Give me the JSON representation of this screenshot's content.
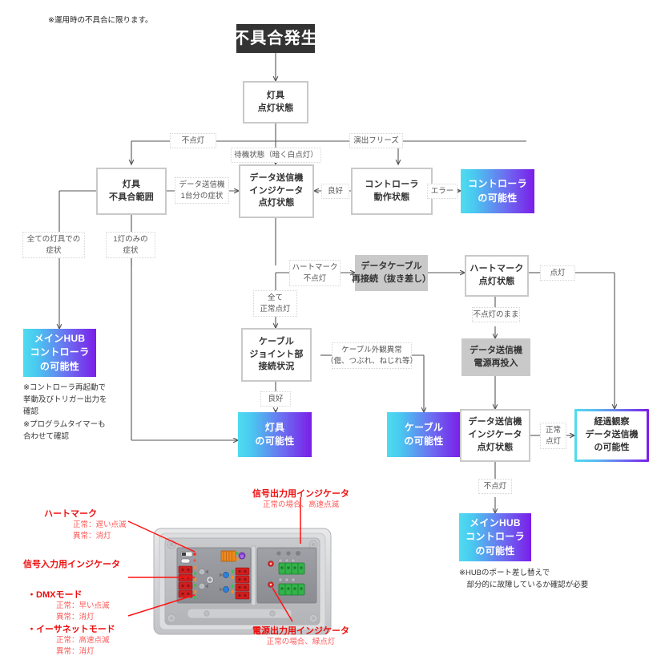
{
  "top_note": "※運用時の不具合に限ります。",
  "nodes": {
    "start": {
      "lines": [
        "不具合発生"
      ]
    },
    "fixture_state": {
      "lines": [
        "灯具",
        "点灯状態"
      ]
    },
    "fixture_range": {
      "lines": [
        "灯具",
        "不具合範囲"
      ]
    },
    "tx_indicator": {
      "lines": [
        "データ送信機",
        "インジケータ",
        "点灯状態"
      ]
    },
    "controller_state": {
      "lines": [
        "コントローラ",
        "動作状態"
      ]
    },
    "controller_maybe": {
      "lines": [
        "コントローラ",
        "の可能性"
      ]
    },
    "mainhub_left": {
      "lines": [
        "メインHUB",
        "コントローラ",
        "の可能性"
      ]
    },
    "datacable_recon": {
      "lines": [
        "データケーブル",
        "再接続（抜き差し）"
      ]
    },
    "heartmark_state": {
      "lines": [
        "ハートマーク",
        "点灯状態"
      ]
    },
    "cable_joint": {
      "lines": [
        "ケーブル",
        "ジョイント部",
        "接続状況"
      ]
    },
    "tx_power_cycle": {
      "lines": [
        "データ送信機",
        "電源再投入"
      ]
    },
    "fixture_maybe": {
      "lines": [
        "灯具",
        "の可能性"
      ]
    },
    "cable_maybe": {
      "lines": [
        "ケーブル",
        "の可能性"
      ]
    },
    "tx_indicator2": {
      "lines": [
        "データ送信機",
        "インジケータ",
        "点灯状態"
      ]
    },
    "observe_tx_maybe": {
      "lines": [
        "経過観察",
        "データ送信機",
        "の可能性"
      ]
    },
    "mainhub_right": {
      "lines": [
        "メインHUB",
        "コントローラ",
        "の可能性"
      ]
    }
  },
  "edge_labels": {
    "no_light": {
      "lines": [
        "不点灯"
      ]
    },
    "standby": {
      "lines": [
        "待機状態（暗く白点灯）"
      ]
    },
    "show_freeze": {
      "lines": [
        "演出フリーズ"
      ]
    },
    "one_tx_symptom": {
      "lines": [
        "データ送信機",
        "1台分の症状"
      ]
    },
    "good": {
      "lines": [
        "良好"
      ]
    },
    "error": {
      "lines": [
        "エラー"
      ]
    },
    "all_fixtures": {
      "lines": [
        "全ての灯具での",
        "症状"
      ]
    },
    "one_fixture": {
      "lines": [
        "1灯のみの",
        "症状"
      ]
    },
    "heart_no_light": {
      "lines": [
        "ハートマーク",
        "不点灯"
      ]
    },
    "all_normal": {
      "lines": [
        "全て",
        "正常点灯"
      ]
    },
    "lit": {
      "lines": [
        "点灯"
      ]
    },
    "cable_damage": {
      "lines": [
        "ケーブル外観異常",
        "（傷、つぶれ、ねじれ等）"
      ]
    },
    "still_no_light": {
      "lines": [
        "不点灯のまま"
      ]
    },
    "joint_good": {
      "lines": [
        "良好"
      ]
    },
    "normal_lit": {
      "lines": [
        "正常",
        "点灯"
      ]
    },
    "no_light_2": {
      "lines": [
        "不点灯"
      ]
    }
  },
  "notes": {
    "controller_note": "※コントローラ再起動で\n挙動及びトリガー出力を\n確認\n※プログラムタイマーも\n合わせて確認",
    "hub_note": "※HUBのポート差し替えで\n　部分的に故障しているか確認が必要"
  },
  "annotations": {
    "heart_mark": {
      "title": "ハートマーク",
      "detail": "正常：遅い点滅\n異常：消灯"
    },
    "signal_in": {
      "title": "信号入力用インジケータ",
      "detail": ""
    },
    "dmx": {
      "title": "・DMXモード",
      "detail": "正常：早い点滅\n異常：消灯"
    },
    "ethernet": {
      "title": "・イーサネットモード",
      "detail": "正常：高速点滅\n異常：消灯"
    },
    "signal_out": {
      "title": "信号出力用インジケータ",
      "detail": "正常の場合、高速点滅"
    },
    "power_out": {
      "title": "電源出力用インジケータ",
      "detail": "正常の場合、緑点灯"
    }
  },
  "colors": {
    "gradient_start": "#4fdcef",
    "gradient_end": "#7a1ee8",
    "dark_box": "#333333",
    "gray_box": "#c9c9c9",
    "border_gray": "#c9c9c9",
    "annotation_red": "#ee0d0d",
    "wire": "#555555"
  }
}
